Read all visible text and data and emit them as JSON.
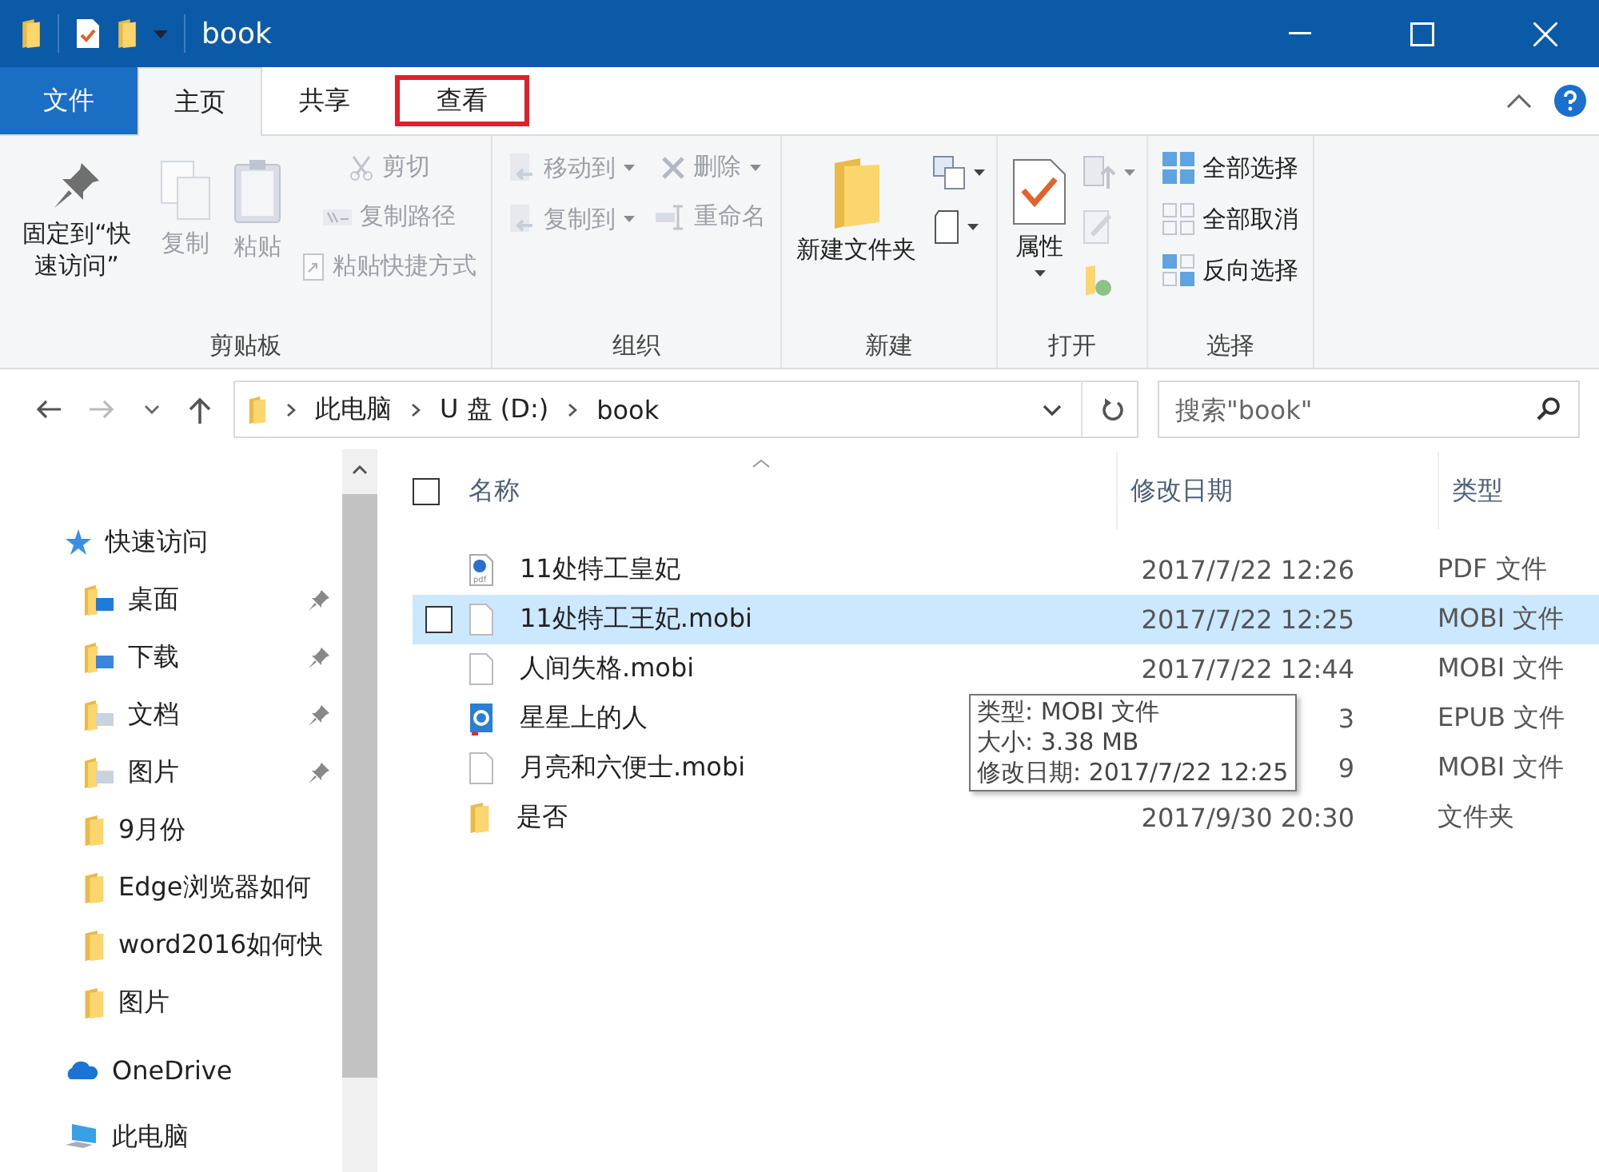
{
  "window": {
    "title": "book"
  },
  "tabs": [
    {
      "label": "文件",
      "kind": "file",
      "selected": false,
      "highlighted": false
    },
    {
      "label": "主页",
      "kind": "tab",
      "selected": true,
      "highlighted": false
    },
    {
      "label": "共享",
      "kind": "tab",
      "selected": false,
      "highlighted": false
    },
    {
      "label": "查看",
      "kind": "tab",
      "selected": false,
      "highlighted": true
    }
  ],
  "ribbon": {
    "groups": [
      {
        "label": "剪贴板",
        "columns": [
          [
            {
              "kind": "large",
              "label": "固定到“快速访问”",
              "disabled": false,
              "dropdown": false
            }
          ],
          [
            {
              "kind": "large",
              "label": "复制",
              "disabled": true,
              "dropdown": false
            }
          ],
          [
            {
              "kind": "large",
              "label": "粘贴",
              "disabled": true,
              "dropdown": false
            }
          ],
          [
            {
              "kind": "small",
              "label": "剪切",
              "disabled": true,
              "dropdown": false
            },
            {
              "kind": "small",
              "label": "复制路径",
              "disabled": true,
              "dropdown": false
            },
            {
              "kind": "small",
              "label": "粘贴快捷方式",
              "disabled": true,
              "dropdown": false
            }
          ]
        ]
      },
      {
        "label": "组织",
        "columns": [
          [
            {
              "kind": "small",
              "label": "移动到",
              "disabled": true,
              "dropdown": true
            },
            {
              "kind": "small",
              "label": "复制到",
              "disabled": true,
              "dropdown": true
            }
          ],
          [
            {
              "kind": "small",
              "label": "删除",
              "disabled": true,
              "dropdown": true
            },
            {
              "kind": "small",
              "label": "重命名",
              "disabled": true,
              "dropdown": false
            }
          ]
        ]
      },
      {
        "label": "新建",
        "columns": [
          [
            {
              "kind": "large",
              "label": "新建文件夹",
              "disabled": false,
              "dropdown": false
            }
          ],
          [
            {
              "kind": "icon",
              "disabled": false,
              "dropdown": true
            },
            {
              "kind": "icon",
              "disabled": false,
              "dropdown": true
            }
          ]
        ]
      },
      {
        "label": "打开",
        "columns": [
          [
            {
              "kind": "large",
              "label": "属性",
              "disabled": false,
              "dropdown": true
            }
          ],
          [
            {
              "kind": "icon",
              "disabled": true,
              "dropdown": true
            },
            {
              "kind": "icon",
              "disabled": true,
              "dropdown": false
            },
            {
              "kind": "icon",
              "disabled": false,
              "dropdown": false
            }
          ]
        ]
      },
      {
        "label": "选择",
        "columns": [
          [
            {
              "kind": "small",
              "label": "全部选择",
              "disabled": false,
              "dropdown": false
            },
            {
              "kind": "small",
              "label": "全部取消",
              "disabled": false,
              "dropdown": false
            },
            {
              "kind": "small",
              "label": "反向选择",
              "disabled": false,
              "dropdown": false
            }
          ]
        ]
      }
    ]
  },
  "address": {
    "segments": [
      "此电脑",
      "U 盘 (D:)",
      "book"
    ]
  },
  "search": {
    "placeholder": "搜索\"book\""
  },
  "nav": [
    {
      "label": "快速访问",
      "kind": "quick",
      "pinned": false
    },
    {
      "label": "桌面",
      "kind": "desktop",
      "pinned": true
    },
    {
      "label": "下载",
      "kind": "downloads",
      "pinned": true
    },
    {
      "label": "文档",
      "kind": "documents",
      "pinned": true
    },
    {
      "label": "图片",
      "kind": "pictures",
      "pinned": true
    },
    {
      "label": "9月份",
      "kind": "folder",
      "pinned": false
    },
    {
      "label": "Edge浏览器如何",
      "kind": "folder",
      "pinned": false
    },
    {
      "label": "word2016如何快",
      "kind": "folder",
      "pinned": false
    },
    {
      "label": "图片",
      "kind": "folder",
      "pinned": false
    },
    {
      "label": "OneDrive",
      "kind": "cloud",
      "pinned": false
    },
    {
      "label": "此电脑",
      "kind": "pc",
      "pinned": false
    }
  ],
  "columns": [
    "名称",
    "修改日期",
    "类型"
  ],
  "select_all": {
    "checked": false
  },
  "files": [
    {
      "name": "11处特工皇妃",
      "date": "2017/7/22 12:26",
      "type": "PDF 文件",
      "kind": "pdf",
      "selected": false
    },
    {
      "name": "11处特工王妃.mobi",
      "date": "2017/7/22 12:25",
      "type": "MOBI 文件",
      "kind": "file",
      "selected": true,
      "checked": false
    },
    {
      "name": "人间失格.mobi",
      "date": "2017/7/22 12:44",
      "type": "MOBI 文件",
      "kind": "file",
      "selected": false
    },
    {
      "name": "星星上的人",
      "date": "3",
      "type": "EPUB 文件",
      "kind": "epub",
      "selected": false
    },
    {
      "name": "月亮和六便士.mobi",
      "date": "9",
      "type": "MOBI 文件",
      "kind": "file",
      "selected": false
    },
    {
      "name": "是否",
      "date": "2017/9/30 20:30",
      "type": "文件夹",
      "kind": "folder",
      "selected": false
    }
  ],
  "tooltip": {
    "lines": [
      "类型: MOBI 文件",
      "大小: 3.38 MB",
      "修改日期: 2017/7/22 12:25"
    ]
  }
}
